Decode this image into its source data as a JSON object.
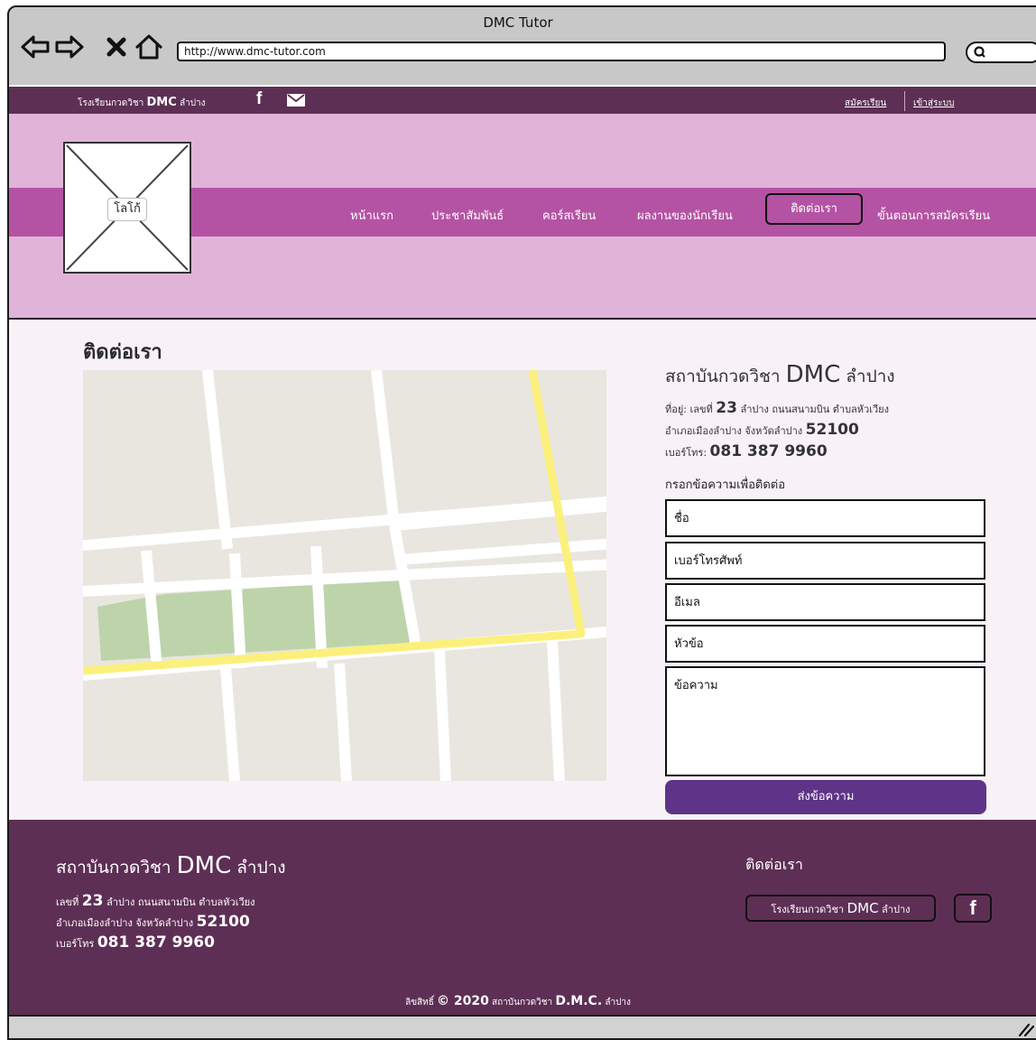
{
  "browser": {
    "window_title": "DMC Tutor",
    "url": "http://www.dmc-tutor.com",
    "icons": [
      "back-arrow-icon",
      "forward-arrow-icon",
      "close-x-icon",
      "home-icon",
      "search-icon"
    ]
  },
  "topbar": {
    "school_prefix": "โรงเรียนกวดวิชา ",
    "school_brand": "DMC",
    "school_suffix": " ลำปาง",
    "register_label": "สมัครเรียน",
    "login_label": "เข้าสู่ระบบ",
    "facebook_glyph": "f",
    "icons": [
      "facebook-icon",
      "mail-icon"
    ]
  },
  "header": {
    "logo_label": "โลโก้",
    "nav": [
      {
        "label": "หน้าแรก"
      },
      {
        "label": "ประชาสัมพันธ์"
      },
      {
        "label": "คอร์สเรียน"
      },
      {
        "label": "ผลงานของนักเรียน"
      },
      {
        "label": "ติดต่อเรา",
        "active": true
      },
      {
        "label": "ขั้นตอนการสมัครเรียน"
      }
    ]
  },
  "main": {
    "title": "ติดต่อเรา",
    "institute": {
      "prefix": "สถาบันกวดวิชา ",
      "brand": "DMC",
      "suffix": " ลำปาง"
    },
    "address1_prefix": "ที่อยู่: เลขที่ ",
    "address1_num": "23",
    "address1_suffix": " ลำปาง ถนนสนามบิน ตำบลหัวเวียง",
    "address2_prefix": "อำเภอเมืองลำปาง จังหวัดลำปาง ",
    "address2_num": "52100",
    "phone_prefix": "เบอร์โทร: ",
    "phone_num": "081 387 9960",
    "form_heading": "กรอกข้อความเพื่อติดต่อ",
    "fields": {
      "name": "ชื่อ",
      "phone": "เบอร์โทรศัพท์",
      "email": "อีเมล",
      "subject": "หัวข้อ",
      "message": "ข้อความ"
    },
    "send_label": "ส่งข้อความ"
  },
  "footer": {
    "institute_prefix": "สถาบันกวดวิชา ",
    "institute_brand": "DMC",
    "institute_suffix": " ลำปาง",
    "line1_prefix": "เลขที่ ",
    "line1_num": "23",
    "line1_suffix": " ลำปาง ถนนสนามบิน ตำบลหัวเวียง",
    "line2_prefix": "อำเภอเมืองลำปาง จังหวัดลำปาง ",
    "line2_num": "52100",
    "line3_prefix": "เบอร์โทร ",
    "line3_num": "081 387 9960",
    "contact_title": "ติดต่อเรา",
    "fb_prefix": "โรงเรียนกวดวิชา ",
    "fb_brand": "DMC",
    "fb_suffix": " ลำปาง",
    "fb_glyph": "f",
    "copyright_prefix": "ลิขสิทธิ์ ",
    "copyright_year": "© 2020",
    "copyright_mid": " สถาบันกวดวิชา ",
    "copyright_brand": "D.M.C.",
    "copyright_suffix": " ลำปาง"
  },
  "colors": {
    "dark_plum": "#5e2f55",
    "header_pink": "#e0b4d9",
    "nav_magenta": "#b453a3",
    "button_purple": "#5e3388",
    "page_bg": "#f8f1f7"
  }
}
